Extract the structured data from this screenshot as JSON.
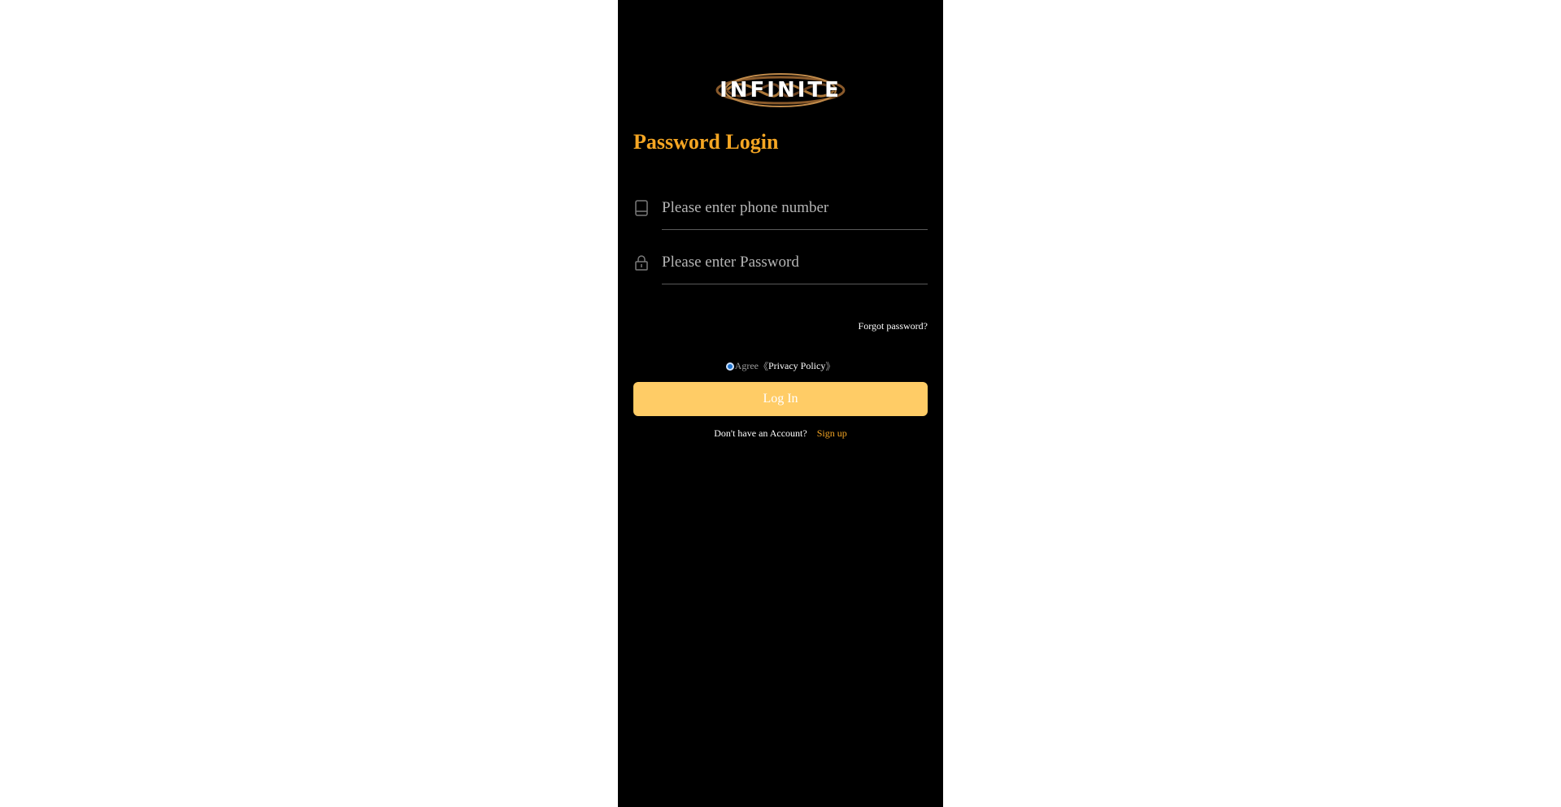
{
  "brand": {
    "logo_text": "INFINITE",
    "colors": {
      "accent": "#f5a623",
      "button": "#ffcc66",
      "background": "#000000"
    }
  },
  "page": {
    "title": "Password Login"
  },
  "form": {
    "phone": {
      "icon": "phone-icon",
      "placeholder": "Please enter phone number",
      "value": ""
    },
    "password": {
      "icon": "lock-icon",
      "placeholder": "Please enter Password",
      "value": ""
    },
    "forgot_label": "Forgot password?",
    "agree": {
      "prefix": "Agree",
      "open_bracket": "《",
      "policy_label": "Privacy Policy",
      "close_bracket": "》",
      "checked": true
    },
    "login_label": "Log In"
  },
  "footer": {
    "question": "Don't have an Account?",
    "signup_label": "Sign up"
  }
}
